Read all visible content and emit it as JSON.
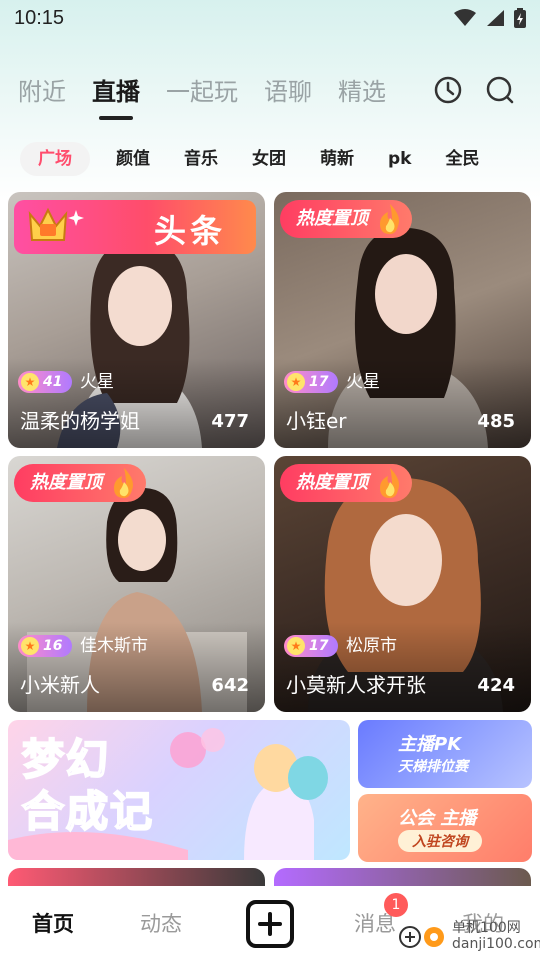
{
  "status": {
    "time": "10:15"
  },
  "tabs": [
    {
      "label": "附近",
      "active": false
    },
    {
      "label": "直播",
      "active": true
    },
    {
      "label": "一起玩",
      "active": false
    },
    {
      "label": "语聊",
      "active": false
    },
    {
      "label": "精选",
      "active": false
    }
  ],
  "top_icons": [
    "history-icon",
    "search-icon"
  ],
  "categories": [
    "广场",
    "颜值",
    "音乐",
    "女团",
    "萌新",
    "pk",
    "全民"
  ],
  "cards": [
    {
      "badge_type": "headline",
      "badge": "头条",
      "level": "41",
      "city": "火星",
      "name": "温柔的杨学姐",
      "viewers": "477"
    },
    {
      "badge_type": "hot",
      "badge": "热度置顶",
      "level": "17",
      "city": "火星",
      "name": "小钰er",
      "viewers": "485"
    },
    {
      "badge_type": "hot",
      "badge": "热度置顶",
      "level": "16",
      "city": "佳木斯市",
      "name": "小米新人",
      "viewers": "642"
    },
    {
      "badge_type": "hot",
      "badge": "热度置顶",
      "level": "17",
      "city": "松原市",
      "name": "小莫新人求开张",
      "viewers": "424"
    }
  ],
  "banners": {
    "big_title_line1": "梦幻",
    "big_title_line2": "合成记",
    "pk_title": "主播PK",
    "pk_subtitle": "天梯排位赛",
    "guild_title": "公会 主播",
    "guild_subtitle": "入驻咨询"
  },
  "bottom_nav": {
    "home": "首页",
    "feed": "动态",
    "messages": "消息",
    "mine": "我的",
    "messages_badge": "1"
  },
  "watermark": {
    "line1": "单机100网",
    "line2": "danji100.com"
  },
  "colors": {
    "accent": "#ff4d6d",
    "hot_badge": "#ff3d62"
  }
}
